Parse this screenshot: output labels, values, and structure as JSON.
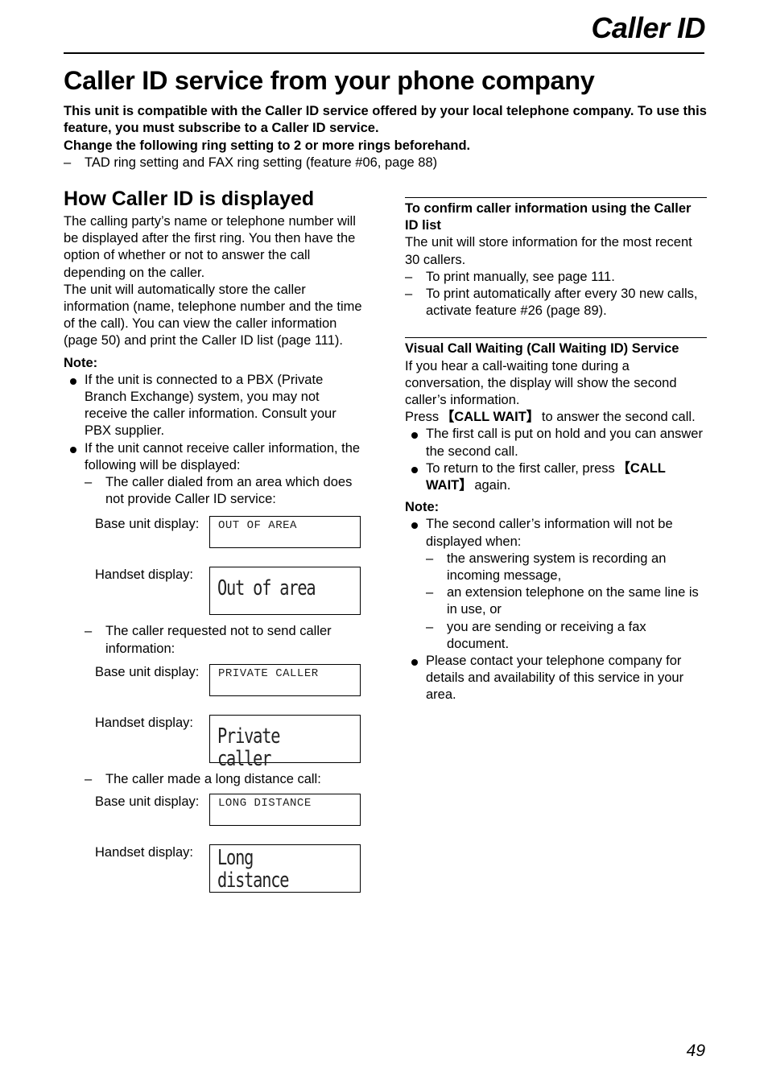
{
  "header": {
    "section_title": "Caller ID",
    "page_title": "Caller ID service from your phone company"
  },
  "intro": {
    "bold_line_1": "This unit is compatible with the Caller ID service offered by your local telephone company. To use this feature, you must subscribe to a Caller ID service.",
    "bold_line_2": "Change the following ring setting to 2 or more rings beforehand.",
    "dash_item": "TAD ring setting and FAX ring setting (feature #06, page 88)"
  },
  "left": {
    "heading": "How Caller ID is displayed",
    "para_1": "The calling party’s name or telephone number will be displayed after the first ring. You then have the option of whether or not to answer the call depending on the caller.",
    "para_2": "The unit will automatically store the caller information (name, telephone number and the time of the call). You can view the caller information (page 50) and print the Caller ID list (page 111).",
    "note_label": "Note:",
    "bullet_1": "If the unit is connected to a PBX (Private Branch Exchange) system, you may not receive the caller information. Consult your PBX supplier.",
    "bullet_2": "If the unit cannot receive caller information, the following will be displayed:",
    "cases": [
      {
        "description": "The caller dialed from an area which does not provide Caller ID service:",
        "base_label": "Base unit display:",
        "base_text": "OUT OF AREA",
        "handset_label": "Handset display:",
        "handset_text": "Out of area"
      },
      {
        "description": "The caller requested not to send caller information:",
        "base_label": "Base unit display:",
        "base_text": "PRIVATE CALLER",
        "handset_label": "Handset display:",
        "handset_text": "Private caller"
      },
      {
        "description": "The caller made a long distance call:",
        "base_label": "Base unit display:",
        "base_text": "LONG DISTANCE",
        "handset_label": "Handset display:",
        "handset_text": "Long distance"
      }
    ]
  },
  "right": {
    "confirm": {
      "heading": "To confirm caller information using the Caller ID list",
      "para": "The unit will store information for the most recent 30 callers.",
      "items": [
        "To print manually, see page 111.",
        "To print automatically after every 30 new calls, activate feature #26 (page 89)."
      ]
    },
    "visual": {
      "heading": "Visual Call Waiting (Call Waiting ID) Service",
      "para": "If you hear a call-waiting tone during a conversation, the display will show the second caller’s information.",
      "press_prefix": "Press ",
      "key": "CALL WAIT",
      "press_suffix": " to answer the second call.",
      "bullet_1": "The first call is put on hold and you can answer the second call.",
      "bullet_2_prefix": "To return to the first caller, press ",
      "bullet_2_key": "CALL WAIT",
      "bullet_2_suffix": " again.",
      "note_label": "Note:",
      "note_bullet_1": "The second caller’s information will not be displayed when:",
      "note_subitems": [
        "the answering system is recording an incoming message,",
        "an extension telephone on the same line is in use, or",
        "you are sending or receiving a fax document."
      ],
      "note_bullet_2": "Please contact your telephone company for details and availability of this service in your area."
    }
  },
  "footer": {
    "page_number": "49"
  }
}
